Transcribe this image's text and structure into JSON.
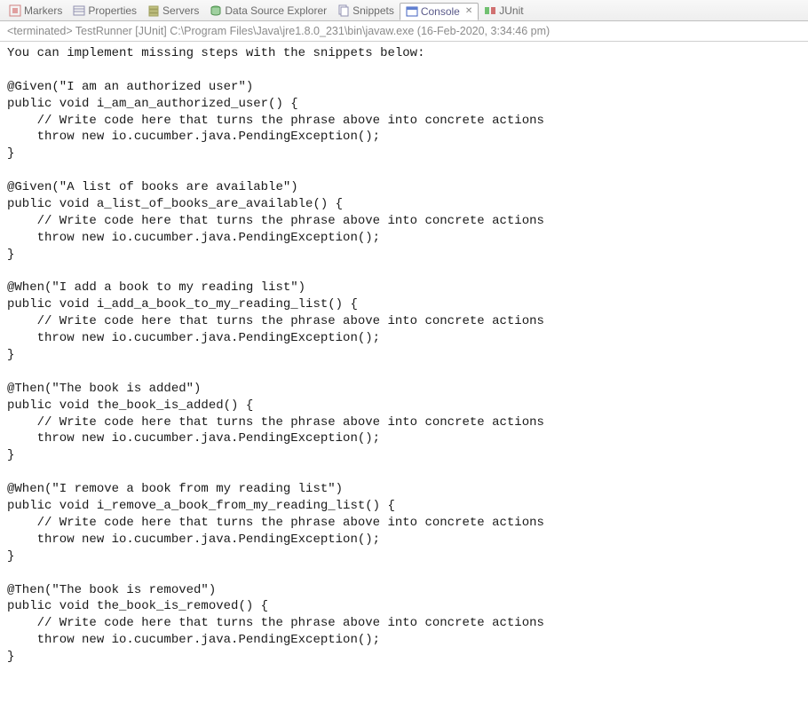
{
  "tabs": [
    {
      "label": "Markers"
    },
    {
      "label": "Properties"
    },
    {
      "label": "Servers"
    },
    {
      "label": "Data Source Explorer"
    },
    {
      "label": "Snippets"
    },
    {
      "label": "Console"
    },
    {
      "label": "JUnit"
    }
  ],
  "status": "<terminated> TestRunner [JUnit] C:\\Program Files\\Java\\jre1.8.0_231\\bin\\javaw.exe (16-Feb-2020, 3:34:46 pm)",
  "console_text": "You can implement missing steps with the snippets below:\n\n@Given(\"I am an authorized user\")\npublic void i_am_an_authorized_user() {\n    // Write code here that turns the phrase above into concrete actions\n    throw new io.cucumber.java.PendingException();\n}\n\n@Given(\"A list of books are available\")\npublic void a_list_of_books_are_available() {\n    // Write code here that turns the phrase above into concrete actions\n    throw new io.cucumber.java.PendingException();\n}\n\n@When(\"I add a book to my reading list\")\npublic void i_add_a_book_to_my_reading_list() {\n    // Write code here that turns the phrase above into concrete actions\n    throw new io.cucumber.java.PendingException();\n}\n\n@Then(\"The book is added\")\npublic void the_book_is_added() {\n    // Write code here that turns the phrase above into concrete actions\n    throw new io.cucumber.java.PendingException();\n}\n\n@When(\"I remove a book from my reading list\")\npublic void i_remove_a_book_from_my_reading_list() {\n    // Write code here that turns the phrase above into concrete actions\n    throw new io.cucumber.java.PendingException();\n}\n\n@Then(\"The book is removed\")\npublic void the_book_is_removed() {\n    // Write code here that turns the phrase above into concrete actions\n    throw new io.cucumber.java.PendingException();\n}"
}
